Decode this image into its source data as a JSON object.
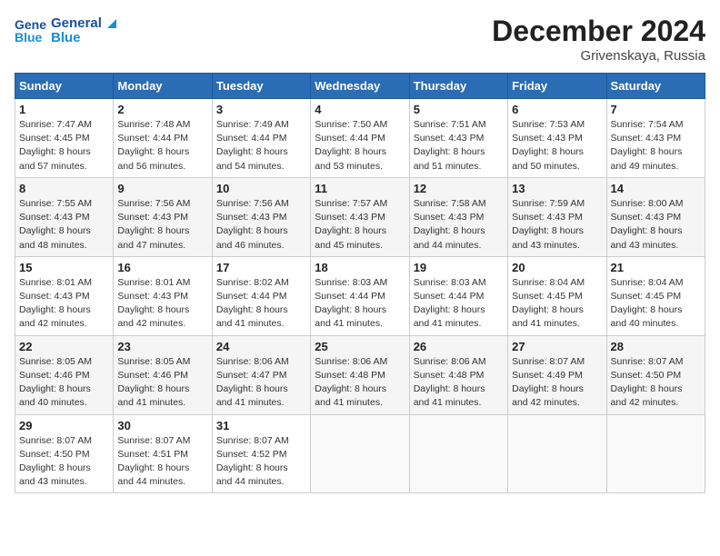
{
  "header": {
    "logo_general": "General",
    "logo_blue": "Blue",
    "month": "December 2024",
    "location": "Grivenskaya, Russia"
  },
  "weekdays": [
    "Sunday",
    "Monday",
    "Tuesday",
    "Wednesday",
    "Thursday",
    "Friday",
    "Saturday"
  ],
  "weeks": [
    [
      {
        "day": "1",
        "sunrise": "Sunrise: 7:47 AM",
        "sunset": "Sunset: 4:45 PM",
        "daylight": "Daylight: 8 hours and 57 minutes."
      },
      {
        "day": "2",
        "sunrise": "Sunrise: 7:48 AM",
        "sunset": "Sunset: 4:44 PM",
        "daylight": "Daylight: 8 hours and 56 minutes."
      },
      {
        "day": "3",
        "sunrise": "Sunrise: 7:49 AM",
        "sunset": "Sunset: 4:44 PM",
        "daylight": "Daylight: 8 hours and 54 minutes."
      },
      {
        "day": "4",
        "sunrise": "Sunrise: 7:50 AM",
        "sunset": "Sunset: 4:44 PM",
        "daylight": "Daylight: 8 hours and 53 minutes."
      },
      {
        "day": "5",
        "sunrise": "Sunrise: 7:51 AM",
        "sunset": "Sunset: 4:43 PM",
        "daylight": "Daylight: 8 hours and 51 minutes."
      },
      {
        "day": "6",
        "sunrise": "Sunrise: 7:53 AM",
        "sunset": "Sunset: 4:43 PM",
        "daylight": "Daylight: 8 hours and 50 minutes."
      },
      {
        "day": "7",
        "sunrise": "Sunrise: 7:54 AM",
        "sunset": "Sunset: 4:43 PM",
        "daylight": "Daylight: 8 hours and 49 minutes."
      }
    ],
    [
      {
        "day": "8",
        "sunrise": "Sunrise: 7:55 AM",
        "sunset": "Sunset: 4:43 PM",
        "daylight": "Daylight: 8 hours and 48 minutes."
      },
      {
        "day": "9",
        "sunrise": "Sunrise: 7:56 AM",
        "sunset": "Sunset: 4:43 PM",
        "daylight": "Daylight: 8 hours and 47 minutes."
      },
      {
        "day": "10",
        "sunrise": "Sunrise: 7:56 AM",
        "sunset": "Sunset: 4:43 PM",
        "daylight": "Daylight: 8 hours and 46 minutes."
      },
      {
        "day": "11",
        "sunrise": "Sunrise: 7:57 AM",
        "sunset": "Sunset: 4:43 PM",
        "daylight": "Daylight: 8 hours and 45 minutes."
      },
      {
        "day": "12",
        "sunrise": "Sunrise: 7:58 AM",
        "sunset": "Sunset: 4:43 PM",
        "daylight": "Daylight: 8 hours and 44 minutes."
      },
      {
        "day": "13",
        "sunrise": "Sunrise: 7:59 AM",
        "sunset": "Sunset: 4:43 PM",
        "daylight": "Daylight: 8 hours and 43 minutes."
      },
      {
        "day": "14",
        "sunrise": "Sunrise: 8:00 AM",
        "sunset": "Sunset: 4:43 PM",
        "daylight": "Daylight: 8 hours and 43 minutes."
      }
    ],
    [
      {
        "day": "15",
        "sunrise": "Sunrise: 8:01 AM",
        "sunset": "Sunset: 4:43 PM",
        "daylight": "Daylight: 8 hours and 42 minutes."
      },
      {
        "day": "16",
        "sunrise": "Sunrise: 8:01 AM",
        "sunset": "Sunset: 4:43 PM",
        "daylight": "Daylight: 8 hours and 42 minutes."
      },
      {
        "day": "17",
        "sunrise": "Sunrise: 8:02 AM",
        "sunset": "Sunset: 4:44 PM",
        "daylight": "Daylight: 8 hours and 41 minutes."
      },
      {
        "day": "18",
        "sunrise": "Sunrise: 8:03 AM",
        "sunset": "Sunset: 4:44 PM",
        "daylight": "Daylight: 8 hours and 41 minutes."
      },
      {
        "day": "19",
        "sunrise": "Sunrise: 8:03 AM",
        "sunset": "Sunset: 4:44 PM",
        "daylight": "Daylight: 8 hours and 41 minutes."
      },
      {
        "day": "20",
        "sunrise": "Sunrise: 8:04 AM",
        "sunset": "Sunset: 4:45 PM",
        "daylight": "Daylight: 8 hours and 41 minutes."
      },
      {
        "day": "21",
        "sunrise": "Sunrise: 8:04 AM",
        "sunset": "Sunset: 4:45 PM",
        "daylight": "Daylight: 8 hours and 40 minutes."
      }
    ],
    [
      {
        "day": "22",
        "sunrise": "Sunrise: 8:05 AM",
        "sunset": "Sunset: 4:46 PM",
        "daylight": "Daylight: 8 hours and 40 minutes."
      },
      {
        "day": "23",
        "sunrise": "Sunrise: 8:05 AM",
        "sunset": "Sunset: 4:46 PM",
        "daylight": "Daylight: 8 hours and 41 minutes."
      },
      {
        "day": "24",
        "sunrise": "Sunrise: 8:06 AM",
        "sunset": "Sunset: 4:47 PM",
        "daylight": "Daylight: 8 hours and 41 minutes."
      },
      {
        "day": "25",
        "sunrise": "Sunrise: 8:06 AM",
        "sunset": "Sunset: 4:48 PM",
        "daylight": "Daylight: 8 hours and 41 minutes."
      },
      {
        "day": "26",
        "sunrise": "Sunrise: 8:06 AM",
        "sunset": "Sunset: 4:48 PM",
        "daylight": "Daylight: 8 hours and 41 minutes."
      },
      {
        "day": "27",
        "sunrise": "Sunrise: 8:07 AM",
        "sunset": "Sunset: 4:49 PM",
        "daylight": "Daylight: 8 hours and 42 minutes."
      },
      {
        "day": "28",
        "sunrise": "Sunrise: 8:07 AM",
        "sunset": "Sunset: 4:50 PM",
        "daylight": "Daylight: 8 hours and 42 minutes."
      }
    ],
    [
      {
        "day": "29",
        "sunrise": "Sunrise: 8:07 AM",
        "sunset": "Sunset: 4:50 PM",
        "daylight": "Daylight: 8 hours and 43 minutes."
      },
      {
        "day": "30",
        "sunrise": "Sunrise: 8:07 AM",
        "sunset": "Sunset: 4:51 PM",
        "daylight": "Daylight: 8 hours and 44 minutes."
      },
      {
        "day": "31",
        "sunrise": "Sunrise: 8:07 AM",
        "sunset": "Sunset: 4:52 PM",
        "daylight": "Daylight: 8 hours and 44 minutes."
      },
      null,
      null,
      null,
      null
    ]
  ]
}
